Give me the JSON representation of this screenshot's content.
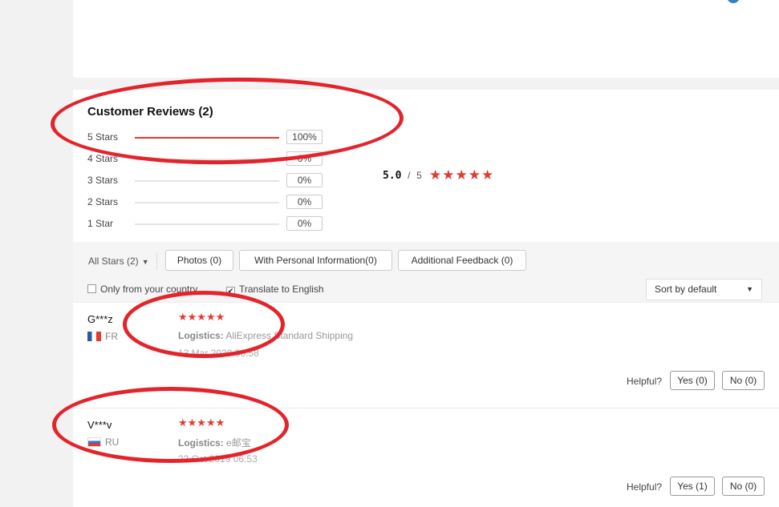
{
  "reviews_summary": {
    "title": "Customer Reviews (2)",
    "distribution": [
      {
        "label": "5 Stars",
        "percent": "100%",
        "fraction": 1.0
      },
      {
        "label": "4 Stars",
        "percent": "0%",
        "fraction": 0
      },
      {
        "label": "3 Stars",
        "percent": "0%",
        "fraction": 0
      },
      {
        "label": "2 Stars",
        "percent": "0%",
        "fraction": 0
      },
      {
        "label": "1 Star",
        "percent": "0%",
        "fraction": 0
      }
    ],
    "average": "5.0",
    "separator": "/",
    "out_of": "5",
    "stars": "★★★★★"
  },
  "filters": {
    "all_stars": "All Stars (2)",
    "photos": "Photos (0)",
    "personal_info": "With Personal Information(0)",
    "additional_feedback": "Additional Feedback (0)",
    "only_country": "Only from your country",
    "translate": "Translate to English",
    "translate_checked": "✔",
    "sort": "Sort by default"
  },
  "reviews": [
    {
      "user": "G***z",
      "country": "FR",
      "stars": "★★★★★",
      "logistics_label": "Logistics:",
      "logistics": "AliExpress Standard Shipping",
      "date": "13 Mar 2020 06:58",
      "helpful_label": "Helpful?",
      "yes": "Yes (0)",
      "no": "No (0)"
    },
    {
      "user": "V***v",
      "country": "RU",
      "stars": "★★★★★",
      "logistics_label": "Logistics:",
      "logistics": "e邮宝",
      "date": "22 Oct 2019 06:53",
      "helpful_label": "Helpful?",
      "yes": "Yes (1)",
      "no": "No (0)"
    }
  ],
  "colors": {
    "accent_red": "#e23a2f",
    "annotation_red": "#e3242b"
  }
}
